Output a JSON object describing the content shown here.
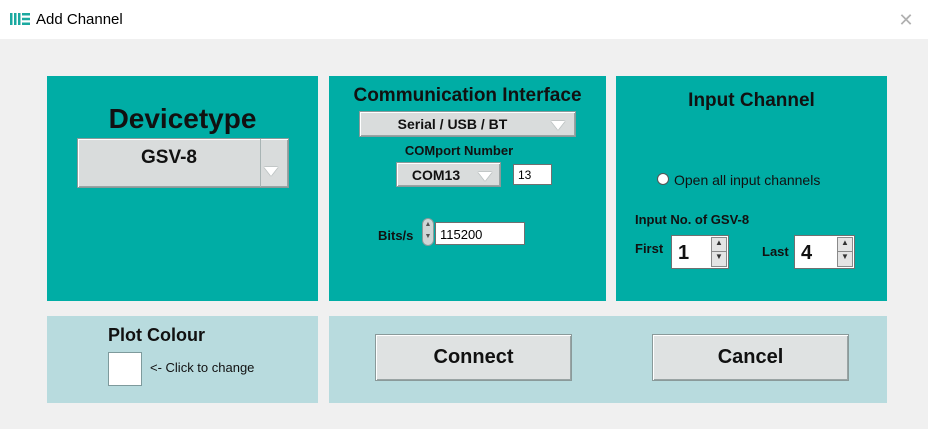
{
  "window": {
    "title": "Add Channel",
    "close_symbol": "✕"
  },
  "device": {
    "heading": "Devicetype",
    "selected": "GSV-8"
  },
  "comm": {
    "heading": "Communication Interface",
    "interface_selected": "Serial / USB / BT",
    "comport_label": "COMport Number",
    "comport_selected": "COM13",
    "comport_number": "13",
    "baud_label": "Bits/s",
    "baud_value": "115200"
  },
  "input": {
    "heading": "Input Channel",
    "open_all_label": "Open all input channels",
    "input_no_label": "Input No. of GSV-8",
    "first_label": "First",
    "first_value": "1",
    "last_label": "Last",
    "last_value": "4"
  },
  "plot": {
    "heading": "Plot Colour",
    "hint": "<- Click to change",
    "swatch_color": "#ffffff"
  },
  "actions": {
    "connect_label": "Connect",
    "cancel_label": "Cancel"
  },
  "colors": {
    "teal": "#00ada5",
    "light_panel": "#b8dbde",
    "background": "#f0f0f0"
  },
  "icons": {
    "logo": "app-logo-icon",
    "dropdown": "triangle-down-icon",
    "spinner": "up-down-arrows-icon",
    "radio": "radio-button-icon"
  }
}
